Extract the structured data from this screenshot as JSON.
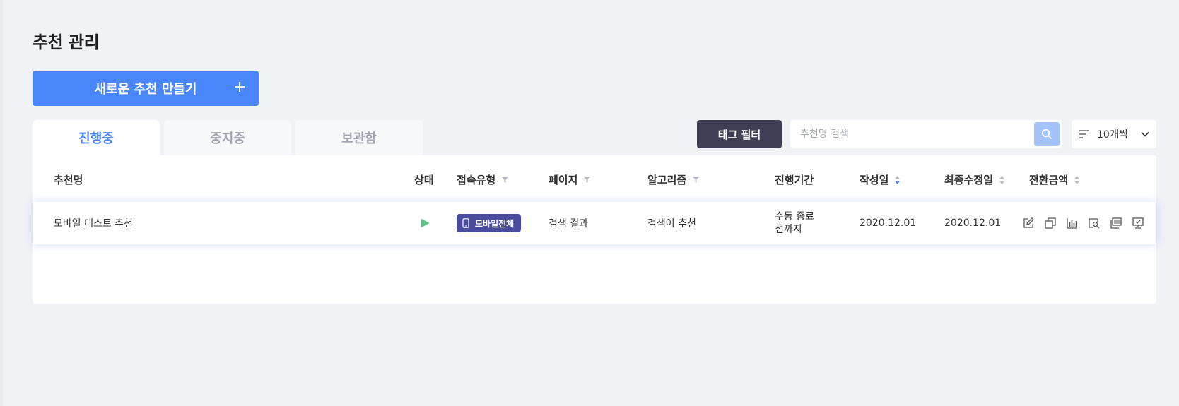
{
  "page": {
    "title": "추천 관리"
  },
  "create_button": {
    "label": "새로운 추천 만들기"
  },
  "tabs": [
    {
      "label": "진행중",
      "active": true
    },
    {
      "label": "중지중",
      "active": false
    },
    {
      "label": "보관함",
      "active": false
    }
  ],
  "toolbar": {
    "tag_filter_label": "태그 필터",
    "search_placeholder": "추천명 검색",
    "page_size_label": "10개씩"
  },
  "table": {
    "columns": {
      "name": "추천명",
      "status": "상태",
      "access_type": "접속유형",
      "page": "페이지",
      "algorithm": "알고리즘",
      "period": "진행기간",
      "created": "작성일",
      "modified": "최종수정일",
      "conversion": "전환금액"
    },
    "rows": [
      {
        "name": "모바일 테스트 추천",
        "status": "running",
        "access_type": "모바일전체",
        "page": "검색 결과",
        "algorithm": "검색어 추천",
        "period_line1": "수동 종료",
        "period_line2": "전까지",
        "created": "2020.12.01",
        "modified": "2020.12.01"
      }
    ]
  },
  "colors": {
    "accent": "#4a86fb",
    "dark_button": "#3f3e55",
    "badge": "#4a4b9d",
    "status_running": "#5ec28a",
    "background": "#f1f2f6"
  },
  "icons": {
    "filter": "funnel-icon",
    "sort": "sort-icon",
    "search": "search-icon",
    "page_size": "list-sort-icon",
    "dropdown": "chevron-down-icon",
    "status": "play-icon",
    "device": "mobile-icon",
    "actions": [
      "edit-icon",
      "copy-icon",
      "bar-chart-icon",
      "preview-search-icon",
      "calendar-report-icon",
      "monitor-check-icon"
    ]
  }
}
